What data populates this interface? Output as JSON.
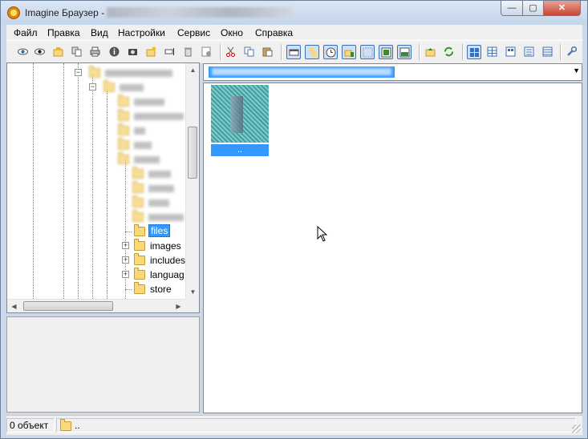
{
  "window": {
    "title": "Imagine Браузер - ",
    "buttons": {
      "minimize": "—",
      "maximize": "▢",
      "close": "✕"
    }
  },
  "menu": [
    "Файл",
    "Правка",
    "Вид",
    "Настройки",
    "Сервис",
    "Окно",
    "Справка"
  ],
  "toolbar": {
    "groups": [
      [
        "view-icon",
        "view-as-icon",
        "open-folder-icon",
        "copy-icon",
        "print-icon",
        "info-icon",
        "camera-icon",
        "new-folder-icon",
        "rename-icon",
        "delete-icon",
        "settings-icon"
      ],
      [
        "cut-icon",
        "copy-files-icon",
        "paste-icon"
      ],
      [
        "filmstrip-icon",
        "toggle-tree-icon",
        "history-icon",
        "folder-sync-icon",
        "dotted-panel-icon",
        "preview-panel-icon",
        "slideshow-icon"
      ],
      [
        "go-up-icon",
        "refresh-icon"
      ],
      [
        "thumbnails-view-icon",
        "list-grid-icon",
        "small-icons-icon",
        "list-icon",
        "details-icon"
      ],
      [
        "tools-wrench-icon"
      ]
    ]
  },
  "tree": {
    "visible_nodes": [
      {
        "label": "files",
        "selected": true
      },
      {
        "label": "images",
        "expandable": true
      },
      {
        "label": "includes",
        "expandable": true
      },
      {
        "label": "languag",
        "expandable": true
      },
      {
        "label": "store"
      }
    ]
  },
  "file_view": {
    "items": [
      {
        "name": ".."
      }
    ]
  },
  "status": {
    "count": "0 объект",
    "path": ".."
  },
  "colors": {
    "selection": "#3399ff",
    "folder": "#f7d87a",
    "window_frame": "#cbd9ea"
  }
}
